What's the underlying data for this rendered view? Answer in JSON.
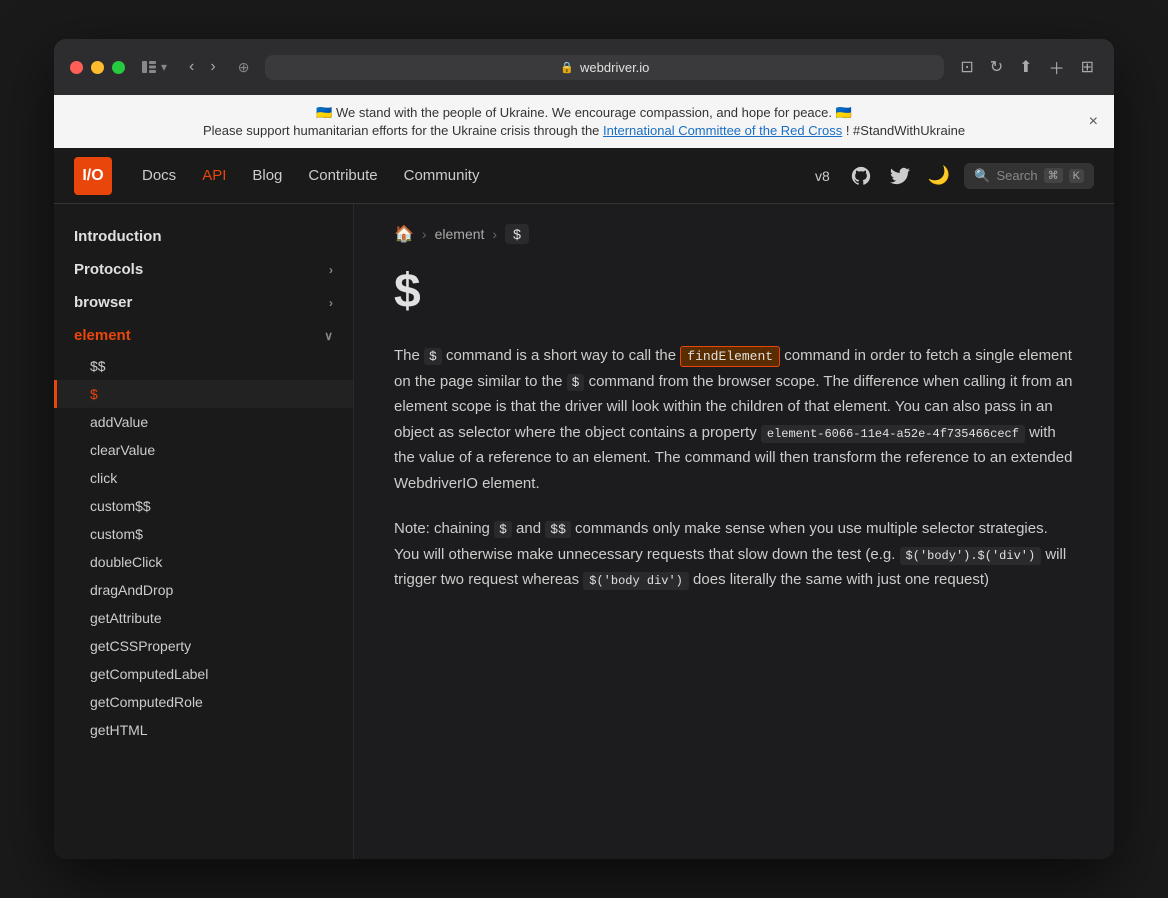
{
  "browser": {
    "address": "webdriver.io",
    "back_btn": "‹",
    "forward_btn": "›"
  },
  "banner": {
    "flag": "🇺🇦",
    "line1": "We stand with the people of Ukraine. We encourage compassion, and hope for peace.",
    "line2_prefix": "Please support humanitarian efforts for the Ukraine crisis through the ",
    "link_text": "International Committee of the Red Cross",
    "line2_suffix": "! #StandWithUkraine"
  },
  "nav": {
    "logo": "I/O",
    "links": [
      {
        "label": "Docs",
        "active": false
      },
      {
        "label": "API",
        "active": true
      },
      {
        "label": "Blog",
        "active": false
      },
      {
        "label": "Contribute",
        "active": false
      },
      {
        "label": "Community",
        "active": false
      }
    ],
    "version": "v8",
    "search_placeholder": "Search",
    "kbd1": "⌘",
    "kbd2": "K"
  },
  "sidebar": {
    "items": [
      {
        "label": "Introduction",
        "expandable": false,
        "active": false
      },
      {
        "label": "Protocols",
        "expandable": true,
        "active": false
      },
      {
        "label": "browser",
        "expandable": true,
        "active": false
      },
      {
        "label": "element",
        "expandable": true,
        "active": true,
        "children": [
          {
            "label": "$$",
            "active": false
          },
          {
            "label": "$",
            "active": true
          },
          {
            "label": "addValue",
            "active": false
          },
          {
            "label": "clearValue",
            "active": false
          },
          {
            "label": "click",
            "active": false
          },
          {
            "label": "custom$$",
            "active": false
          },
          {
            "label": "custom$",
            "active": false
          },
          {
            "label": "doubleClick",
            "active": false
          },
          {
            "label": "dragAndDrop",
            "active": false
          },
          {
            "label": "getAttribute",
            "active": false
          },
          {
            "label": "getCSSProperty",
            "active": false
          },
          {
            "label": "getComputedLabel",
            "active": false
          },
          {
            "label": "getComputedRole",
            "active": false
          },
          {
            "label": "getHTML",
            "active": false
          }
        ]
      }
    ]
  },
  "main": {
    "breadcrumb": {
      "home": "🏠",
      "element": "element",
      "current": "$"
    },
    "title": "$",
    "paragraph1_parts": {
      "pre": "The ",
      "code1": "$",
      "mid1": " command is a short way to call the ",
      "highlighted": "findElement",
      "mid2": " command in order to fetch a single element on the page similar to the ",
      "code2": "$",
      "mid3": " command from the browser scope. The difference when calling it from an element scope is that the driver will look within the children of that element. You can also pass in an object as selector where the object contains a property ",
      "long_code": "element-6066-11e4-a52e-4f735466cecf",
      "end": " with the value of a reference to an element. The command will then transform the reference to an extended WebdriverIO element."
    },
    "paragraph2_parts": {
      "pre": "Note: chaining ",
      "code1": "$",
      "mid1": " and ",
      "code2": "$$",
      "mid2": " commands only make sense when you use multiple selector strategies. You will otherwise make unnecessary requests that slow down the test (e.g. ",
      "code3": "$('body').$('div')",
      "mid3": " will trigger two request whereas ",
      "code4": "$('body div')",
      "end": " does literally the same with just one request)"
    }
  }
}
